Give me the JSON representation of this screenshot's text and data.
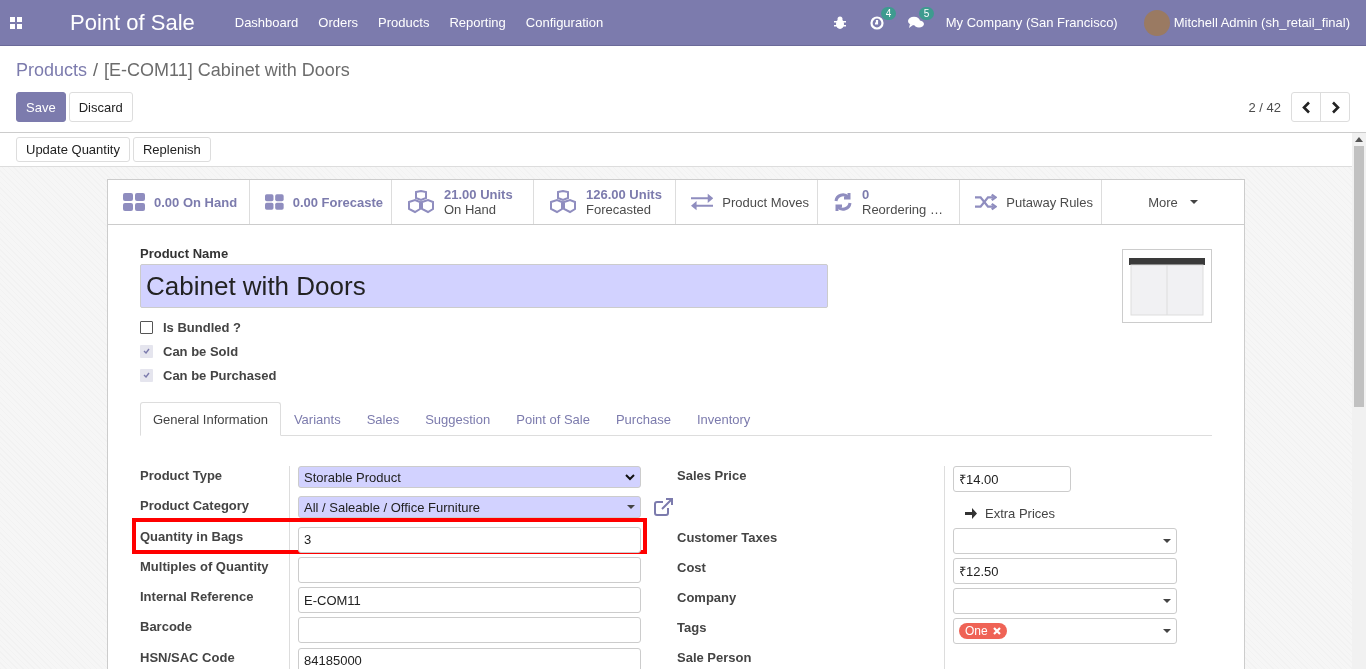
{
  "navbar": {
    "app_title": "Point of Sale",
    "menu": [
      "Dashboard",
      "Orders",
      "Products",
      "Reporting",
      "Configuration"
    ],
    "activity_badge": "4",
    "messages_badge": "5",
    "company": "My Company (San Francisco)",
    "user": "Mitchell Admin (sh_retail_final)"
  },
  "breadcrumb": {
    "items": [
      "Products",
      "[E-COM11] Cabinet with Doors"
    ],
    "separator": "/"
  },
  "form_buttons": [
    {
      "label": "Save",
      "kind": "primary"
    },
    {
      "label": "Discard",
      "kind": "secondary"
    }
  ],
  "pager": {
    "value": "2 / 42"
  },
  "header_buttons": [
    "Update Quantity",
    "Replenish"
  ],
  "smart_buttons": [
    {
      "kind": "inline",
      "text": "0.00 On Hand"
    },
    {
      "kind": "inline",
      "text": "0.00 Forecaste"
    },
    {
      "kind": "stacked",
      "value": "21.00 Units",
      "label": "On Hand"
    },
    {
      "kind": "stacked",
      "value": "126.00 Units",
      "label": "Forecasted"
    },
    {
      "kind": "plain",
      "label": "Product Moves"
    },
    {
      "kind": "stacked",
      "value": "0",
      "label": "Reordering …"
    },
    {
      "kind": "plain",
      "label": "Putaway Rules"
    }
  ],
  "more": "More",
  "product_name_label": "Product Name",
  "product_name": "Cabinet with Doors",
  "options": [
    {
      "label": "Is Bundled ?",
      "checked": false,
      "readonly": false
    },
    {
      "label": "Can be Sold",
      "checked": true,
      "readonly": true
    },
    {
      "label": "Can be Purchased",
      "checked": true,
      "readonly": true
    }
  ],
  "tabs": [
    {
      "label": "General Information",
      "selected": true
    },
    {
      "label": "Variants",
      "selected": false
    },
    {
      "label": "Sales",
      "selected": false
    },
    {
      "label": "Suggestion",
      "selected": false
    },
    {
      "label": "Point of Sale",
      "selected": false
    },
    {
      "label": "Purchase",
      "selected": false
    },
    {
      "label": "Inventory",
      "selected": false
    }
  ],
  "left_fields": [
    {
      "label": "Product Type",
      "kind": "select",
      "value": "Storable Product",
      "required": true,
      "external_link": false,
      "highlighted": false
    },
    {
      "label": "Product Category",
      "kind": "many2one",
      "value": "All / Saleable / Office Furniture",
      "required": true,
      "external_link": true,
      "highlighted": false
    },
    {
      "label": "Quantity in Bags",
      "kind": "input",
      "value": "3",
      "required": false,
      "external_link": false,
      "highlighted": true
    },
    {
      "label": "Multiples of Quantity",
      "kind": "input",
      "required": false,
      "external_link": false,
      "highlighted": false
    },
    {
      "label": "Internal Reference",
      "kind": "input",
      "value": "E-COM11",
      "required": false,
      "external_link": false,
      "highlighted": false
    },
    {
      "label": "Barcode",
      "kind": "input",
      "required": false,
      "external_link": false,
      "highlighted": false
    },
    {
      "label": "HSN/SAC Code",
      "kind": "input",
      "value": "84185000",
      "required": false,
      "external_link": false,
      "highlighted": false
    }
  ],
  "right_fields": [
    {
      "label": "Sales Price",
      "kind": "short_input",
      "value": "₹14.00"
    },
    {
      "kind": "link",
      "text": "Extra Prices"
    },
    {
      "label": "Customer Taxes",
      "kind": "many2one"
    },
    {
      "label": "Cost",
      "kind": "input",
      "value": "₹12.50"
    },
    {
      "label": "Company",
      "kind": "many2one"
    },
    {
      "label": "Tags",
      "kind": "tags",
      "tags": [
        {
          "label": "One",
          "color": "#ef6356"
        }
      ]
    },
    {
      "label": "Sale Person",
      "kind": "label"
    }
  ]
}
